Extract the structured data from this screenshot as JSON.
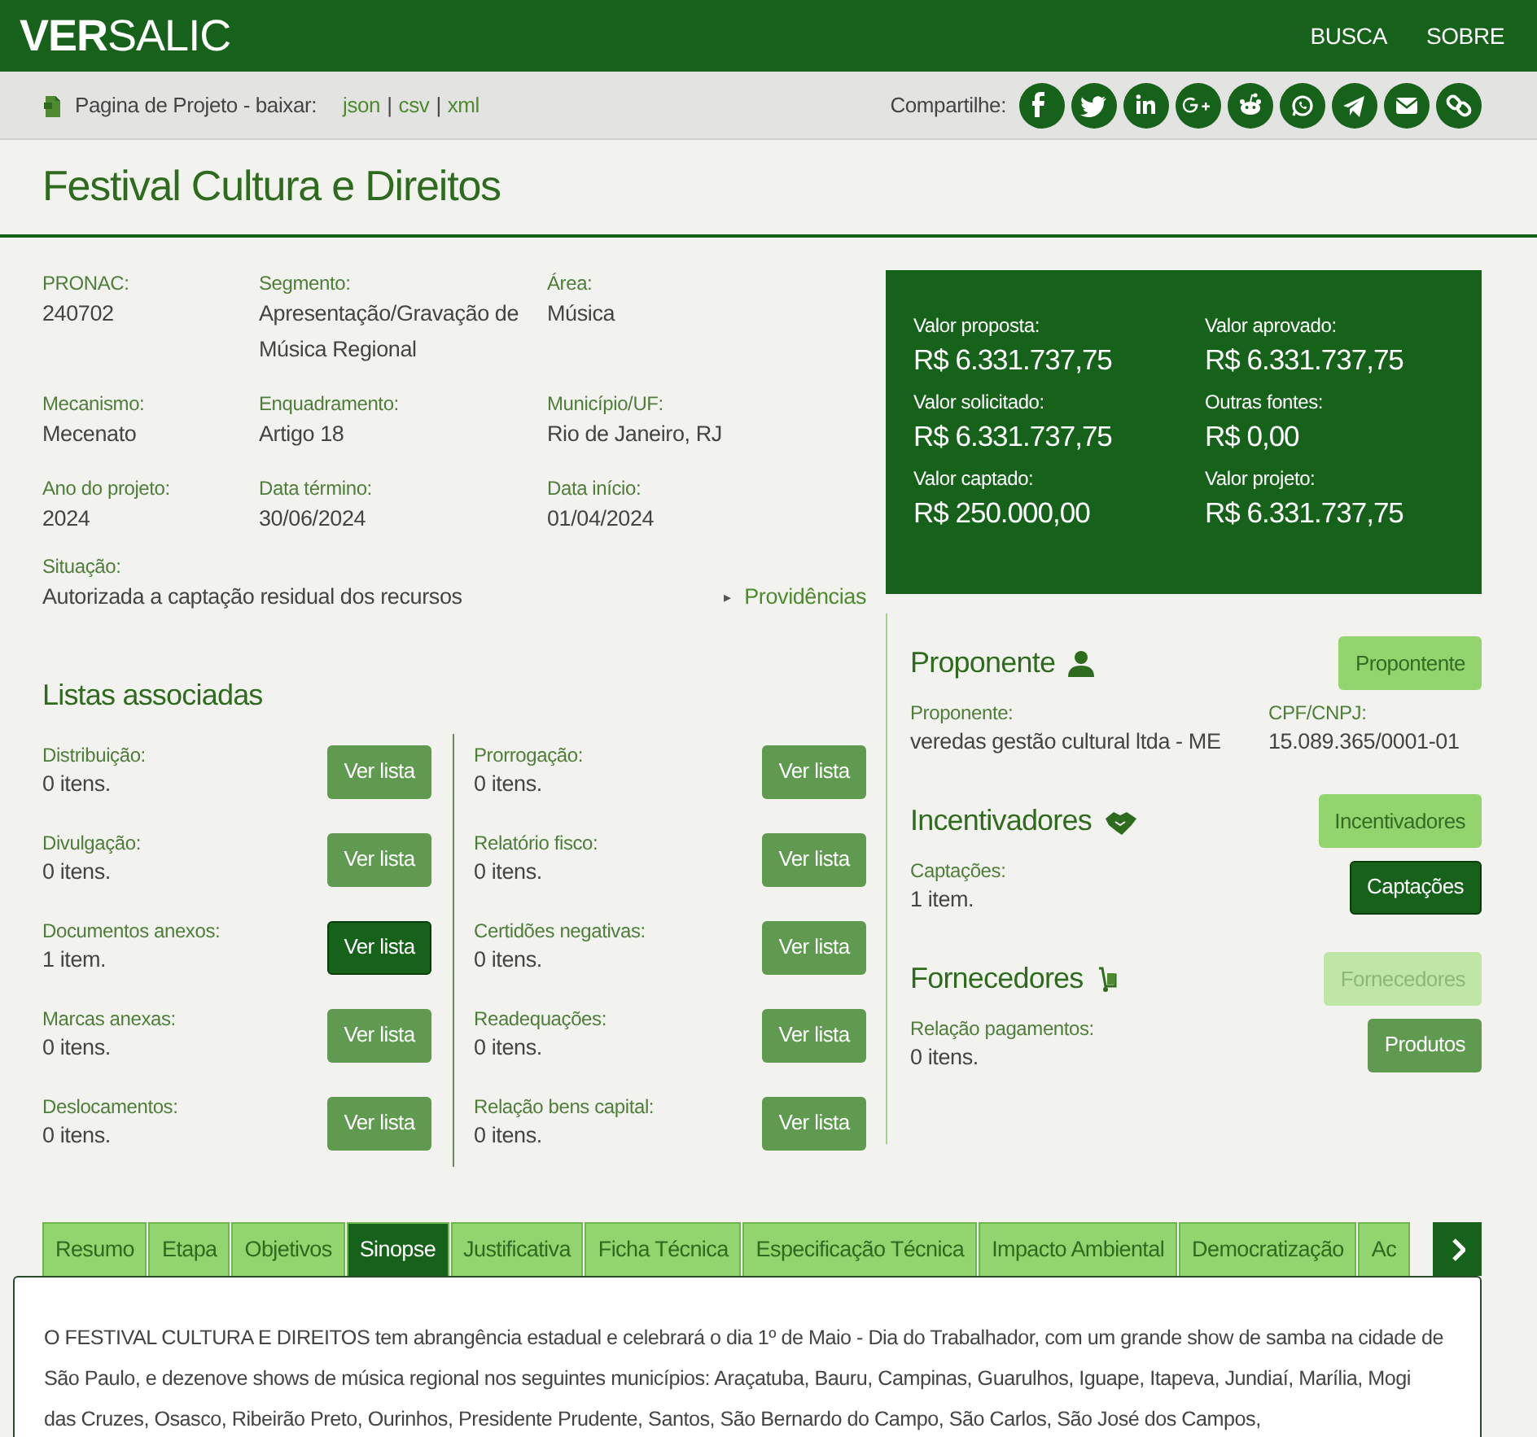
{
  "brand": "**VER**SALIC",
  "nav": [
    "BUSCA",
    "SOBRE"
  ],
  "download": {
    "label": "Pagina de Projeto - baixar:",
    "separator": "|",
    "links": [
      "json",
      "csv",
      "xml"
    ]
  },
  "share": {
    "label": "Compartilhe:"
  },
  "title": "Festival Cultura e Direitos",
  "fields": [
    {
      "label": "PRONAC:",
      "value": "240702"
    },
    {
      "label": "Segmento:",
      "value": "Apresentação/Gravação de Música Regional"
    },
    {
      "label": "Área:",
      "value": "Música"
    },
    {
      "label": "Mecanismo:",
      "value": "Mecenato"
    },
    {
      "label": "Enquadramento:",
      "value": "Artigo 18"
    },
    {
      "label": "Município/UF:",
      "value": "Rio de Janeiro, RJ"
    },
    {
      "label": "Ano do projeto:",
      "value": "2024"
    },
    {
      "label": "Data término:",
      "value": "30/06/2024"
    },
    {
      "label": "Data início:",
      "value": "01/04/2024"
    }
  ],
  "situacao": {
    "label": "Situação:",
    "value": "Autorizada a captação residual dos recursos"
  },
  "providencias": {
    "marker": "▸",
    "label": "Providências"
  },
  "values": [
    {
      "label": "Valor proposta:",
      "value": "R$ 6.331.737,75"
    },
    {
      "label": "Valor aprovado:",
      "value": "R$ 6.331.737,75"
    },
    {
      "label": "Valor solicitado:",
      "value": "R$ 6.331.737,75"
    },
    {
      "label": "Outras fontes:",
      "value": "R$ 0,00"
    },
    {
      "label": "Valor captado:",
      "value": "R$ 250.000,00"
    },
    {
      "label": "Valor projeto:",
      "value": "R$ 6.331.737,75"
    }
  ],
  "listas": {
    "title": "Listas associadas",
    "columns": [
      [
        {
          "label": "Distribuição:",
          "count": "0 itens.",
          "button": "Ver lista",
          "highlighted": false
        },
        {
          "label": "Divulgação:",
          "count": "0 itens.",
          "button": "Ver lista",
          "highlighted": false
        },
        {
          "label": "Documentos anexos:",
          "count": "1 item.",
          "button": "Ver lista",
          "highlighted": true
        },
        {
          "label": "Marcas anexas:",
          "count": "0 itens.",
          "button": "Ver lista",
          "highlighted": false
        },
        {
          "label": "Deslocamentos:",
          "count": "0 itens.",
          "button": "Ver lista",
          "highlighted": false
        }
      ],
      [
        {
          "label": "Prorrogação:",
          "count": "0 itens.",
          "button": "Ver lista",
          "highlighted": false
        },
        {
          "label": "Relatório fisco:",
          "count": "0 itens.",
          "button": "Ver lista",
          "highlighted": false
        },
        {
          "label": "Certidões negativas:",
          "count": "0 itens.",
          "button": "Ver lista",
          "highlighted": false
        },
        {
          "label": "Readequações:",
          "count": "0 itens.",
          "button": "Ver lista",
          "highlighted": false
        },
        {
          "label": "Relação bens capital:",
          "count": "0 itens.",
          "button": "Ver lista",
          "highlighted": false
        }
      ]
    ]
  },
  "sections": [
    {
      "title": "Proponente",
      "button": {
        "label": "Propontente",
        "kind": "light"
      },
      "rows": [
        {
          "fields": [
            {
              "label": "Proponente:",
              "value": "veredas gestão cultural ltda - ME"
            },
            {
              "label": "CPF/CNPJ:",
              "value": "15.089.365/0001-01"
            }
          ]
        }
      ]
    },
    {
      "title": "Incentivadores",
      "button": {
        "label": "Incentivadores",
        "kind": "light"
      },
      "rows": [
        {
          "fields": [
            {
              "label": "Captações:",
              "value": "1 item."
            }
          ],
          "button": {
            "label": "Captações",
            "kind": "dark"
          }
        }
      ]
    },
    {
      "title": "Fornecedores",
      "button": {
        "label": "Fornecedores",
        "kind": "disabled"
      },
      "rows": [
        {
          "fields": [
            {
              "label": "Relação pagamentos:",
              "value": "0 itens."
            }
          ],
          "button": {
            "label": "Produtos",
            "kind": "medium"
          }
        }
      ]
    }
  ],
  "tabs": [
    {
      "label": "Resumo",
      "selected": false
    },
    {
      "label": "Etapa",
      "selected": false
    },
    {
      "label": "Objetivos",
      "selected": false
    },
    {
      "label": "Sinopse",
      "selected": true
    },
    {
      "label": "Justificativa",
      "selected": false
    },
    {
      "label": "Ficha Técnica",
      "selected": false
    },
    {
      "label": "Especificação Técnica",
      "selected": false
    },
    {
      "label": "Impacto Ambiental",
      "selected": false
    },
    {
      "label": "Democratização",
      "selected": false
    },
    {
      "label": "Ac",
      "selected": false
    }
  ],
  "sinopse": "O  FESTIVAL CULTURA E DIREITOS tem abrangência estadual e celebrará o dia 1º de Maio - Dia do Trabalhador, com um grande show de samba na cidade de São Paulo, e dezenove shows de música regional nos seguintes municípios: Araçatuba, Bauru, Campinas, Guarulhos, Iguape, Itapeva, Jundiaí, Marília, Mogi das Cruzes, Osasco, Ribeirão Preto, Ourinhos, Presidente Prudente, Santos, São Bernardo do Campo, São Carlos, São José dos Campos,"
}
